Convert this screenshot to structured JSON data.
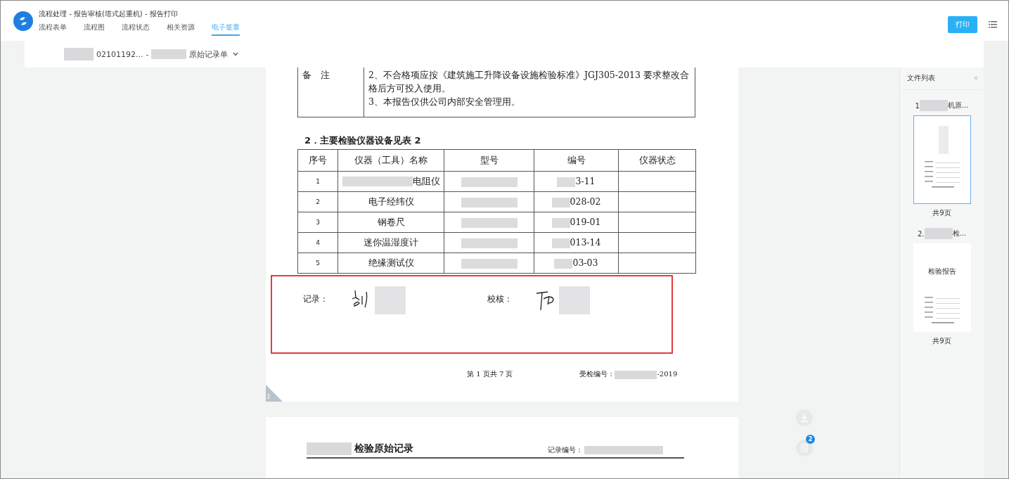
{
  "window": {
    "title": "流程处理 - 报告审核(塔式起重机) - 报告打印"
  },
  "tabs": [
    {
      "label": "流程表单",
      "selected": false
    },
    {
      "label": "流程图",
      "selected": false
    },
    {
      "label": "流程状态",
      "selected": false
    },
    {
      "label": "相关资源",
      "selected": false
    },
    {
      "label": "电子签章",
      "selected": true
    }
  ],
  "print_button": "打印",
  "document_selector": {
    "number": "02101192...",
    "separator": "-",
    "name_tail": "原始记录单"
  },
  "report_page": {
    "remarks": {
      "label": "备　注",
      "lines": [
        "2、不合格项应按《建筑施工升降设备设施检验标准》JGJ305-2013 要求整改合格后方可投入使用。",
        "3、本报告仅供公司内部安全管理用。"
      ]
    },
    "section_title": "2．主要检验仪器设备见表 2",
    "instrument_table": {
      "columns": [
        "序号",
        "仪器（工具）名称",
        "型号",
        "编号",
        "仪器状态"
      ],
      "rows": [
        {
          "no": "1",
          "name": "电阻仪",
          "name_redacted": true,
          "number": "3-11"
        },
        {
          "no": "2",
          "name": "电子经纬仪",
          "name_redacted": false,
          "number": "028-02"
        },
        {
          "no": "3",
          "name": "钢卷尺",
          "name_redacted": false,
          "number": "019-01"
        },
        {
          "no": "4",
          "name": "迷你温湿度计",
          "name_redacted": false,
          "number": "013-14"
        },
        {
          "no": "5",
          "name": "绝缘测试仪",
          "name_redacted": false,
          "number": "03-03"
        }
      ]
    },
    "signatures": [
      {
        "label": "记录："
      },
      {
        "label": "校核："
      }
    ],
    "page_info": "第 1 页共 7 页",
    "inspection_no_label": "受检编号：",
    "inspection_no_tail": "-2019",
    "corner_page": "3"
  },
  "next_page": {
    "title": "检验原始记录",
    "record_no_label": "记录编号："
  },
  "file_list": {
    "title": "文件列表",
    "close": "×",
    "files": [
      {
        "prefix": "1",
        "suffix": "机原...",
        "selected": true,
        "pages": "共9页"
      },
      {
        "prefix": "2.",
        "suffix": "检...",
        "selected": false,
        "pages": "共9页",
        "thumb_title": "检验报告"
      }
    ]
  },
  "floating_actions": {
    "badge": "2"
  }
}
